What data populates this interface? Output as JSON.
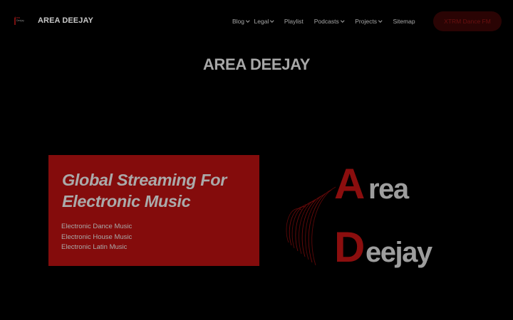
{
  "header": {
    "brand": "AREA DEEJAY",
    "logo_top": "Area",
    "logo_bottom": "Deejay",
    "nav": [
      {
        "label": "Blog",
        "dropdown": true
      },
      {
        "label": "Legal",
        "dropdown": true
      },
      {
        "label": "Playlist",
        "dropdown": false
      },
      {
        "label": "Podcasts",
        "dropdown": true
      },
      {
        "label": "Projects",
        "dropdown": true
      },
      {
        "label": "Sitemap",
        "dropdown": false
      }
    ],
    "cta_label": "XTRM Dance FM"
  },
  "page": {
    "title": "AREA DEEJAY"
  },
  "hero": {
    "heading": "Global Streaming For Electronic Music",
    "list": [
      "Electronic Dance Music",
      "Electronic House Music",
      "Electronic Latin Music"
    ]
  },
  "logo": {
    "letter_a": "A",
    "word_a": "rea",
    "letter_d": "D",
    "word_d": "eejay"
  },
  "colors": {
    "background": "#000000",
    "accent_red": "#840c0c",
    "text_gray": "#aaaaaa"
  }
}
